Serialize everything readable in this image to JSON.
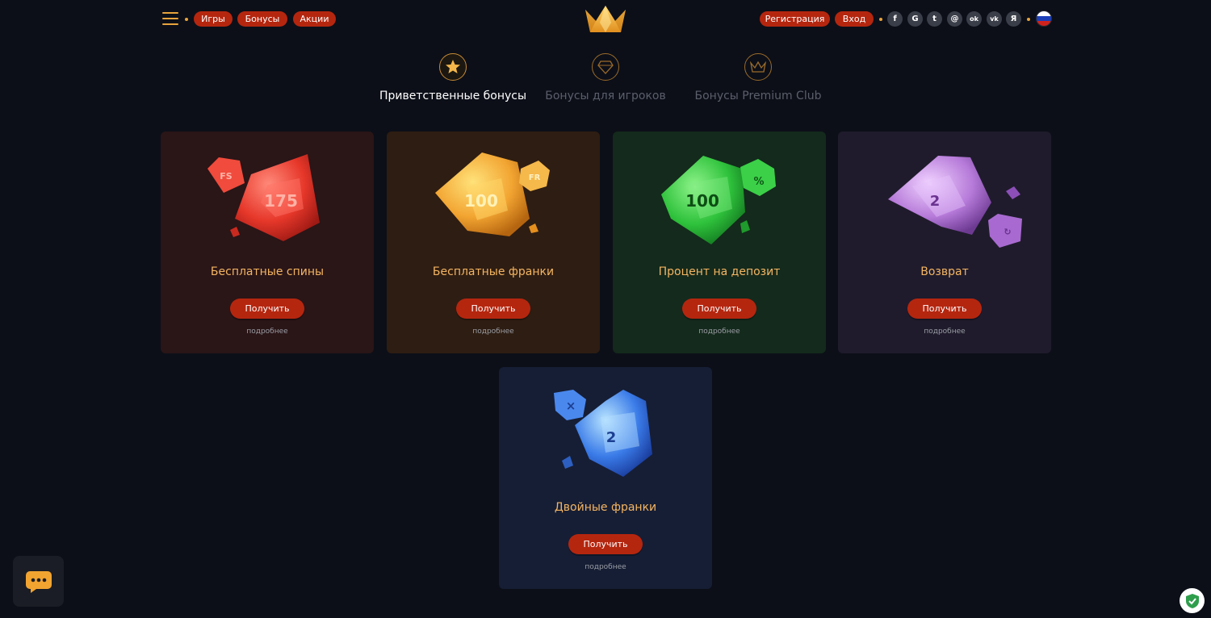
{
  "header": {
    "nav": [
      "Игры",
      "Бонусы",
      "Акции"
    ],
    "register_label": "Регистрация",
    "login_label": "Вход",
    "social": [
      {
        "icon": "facebook-icon",
        "glyph": "f"
      },
      {
        "icon": "google-icon",
        "glyph": "G"
      },
      {
        "icon": "twitter-icon",
        "glyph": "t"
      },
      {
        "icon": "mail-icon",
        "glyph": "@"
      },
      {
        "icon": "odnoklassniki-icon",
        "glyph": "ok"
      },
      {
        "icon": "vk-icon",
        "glyph": "vk"
      },
      {
        "icon": "yandex-icon",
        "glyph": "Я"
      }
    ],
    "language_flag": "russia-flag-icon"
  },
  "tabs": [
    {
      "label": "Приветственные бонусы",
      "icon": "star-icon",
      "active": true
    },
    {
      "label": "Бонусы для игроков",
      "icon": "diamond-icon",
      "active": false
    },
    {
      "label": "Бонусы Premium Club",
      "icon": "crown-icon",
      "active": false
    }
  ],
  "cards": [
    {
      "title": "Бесплатные спины",
      "button": "Получить",
      "more": "подробнее",
      "gem_label": "175",
      "badge": "FS",
      "color": "#e63a2e",
      "bg": "#2a1517"
    },
    {
      "title": "Бесплатные франки",
      "button": "Получить",
      "more": "подробнее",
      "gem_label": "100",
      "badge": "FR",
      "color": "#f2a431",
      "bg": "#2e1d12"
    },
    {
      "title": "Процент на депозит",
      "button": "Получить",
      "more": "подробнее",
      "gem_label": "100",
      "badge": "%",
      "color": "#2fc23c",
      "bg": "#142a1c"
    },
    {
      "title": "Возврат",
      "button": "Получить",
      "more": "подробнее",
      "gem_label": "2",
      "badge": "",
      "color": "#b67ad9",
      "bg": "#1f1b2c"
    },
    {
      "title": "Двойные франки",
      "button": "Получить",
      "more": "подробнее",
      "gem_label": "2",
      "badge": "×",
      "color": "#3a7be8",
      "bg": "#161e35"
    }
  ],
  "colors": {
    "accent": "#b5260f",
    "gold": "#e8a33c",
    "title_text": "#f4b562",
    "background": "#0c0f18"
  }
}
